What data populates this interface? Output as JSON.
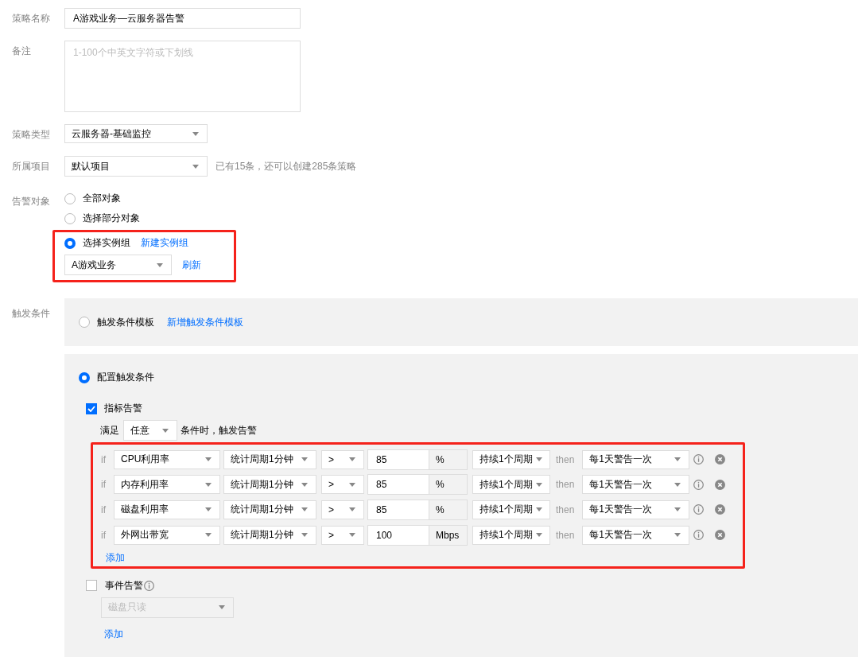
{
  "policy_name": {
    "label": "策略名称",
    "value": "A游戏业务—云服务器告警"
  },
  "remark": {
    "label": "备注",
    "placeholder": "1-100个中英文字符或下划线"
  },
  "policy_type": {
    "label": "策略类型",
    "value": "云服务器-基础监控"
  },
  "project": {
    "label": "所属项目",
    "value": "默认项目",
    "hint": "已有15条，还可以创建285条策略"
  },
  "alarm_object": {
    "label": "告警对象",
    "options": [
      {
        "label": "全部对象",
        "selected": false
      },
      {
        "label": "选择部分对象",
        "selected": false
      },
      {
        "label": "选择实例组",
        "selected": true
      }
    ],
    "new_group_link": "新建实例组",
    "group_value": "A游戏业务",
    "refresh_link": "刷新"
  },
  "trigger": {
    "label": "触发条件",
    "template_option": {
      "label": "触发条件模板",
      "selected": false,
      "link": "新增触发条件模板"
    },
    "config_option": {
      "label": "配置触发条件",
      "selected": true
    },
    "metric_alarm": {
      "label": "指标告警",
      "checked": true,
      "satisfy_prefix": "满足",
      "satisfy_value": "任意",
      "satisfy_suffix": "条件时，触发告警",
      "rows": [
        {
          "if": "if",
          "metric": "CPU利用率",
          "period": "统计周期1分钟",
          "operator": ">",
          "value": "85",
          "unit": "%",
          "duration": "持续1个周期",
          "then": "then",
          "frequency": "每1天警告一次"
        },
        {
          "if": "if",
          "metric": "内存利用率",
          "period": "统计周期1分钟",
          "operator": ">",
          "value": "85",
          "unit": "%",
          "duration": "持续1个周期",
          "then": "then",
          "frequency": "每1天警告一次"
        },
        {
          "if": "if",
          "metric": "磁盘利用率",
          "period": "统计周期1分钟",
          "operator": ">",
          "value": "85",
          "unit": "%",
          "duration": "持续1个周期",
          "then": "then",
          "frequency": "每1天警告一次"
        },
        {
          "if": "if",
          "metric": "外网出带宽",
          "period": "统计周期1分钟",
          "operator": ">",
          "value": "100",
          "unit": "Mbps",
          "duration": "持续1个周期",
          "then": "then",
          "frequency": "每1天警告一次"
        }
      ],
      "add_link": "添加"
    },
    "event_alarm": {
      "label": "事件告警",
      "checked": false,
      "select_value": "磁盘只读",
      "select_disabled": true,
      "add_link": "添加"
    }
  }
}
